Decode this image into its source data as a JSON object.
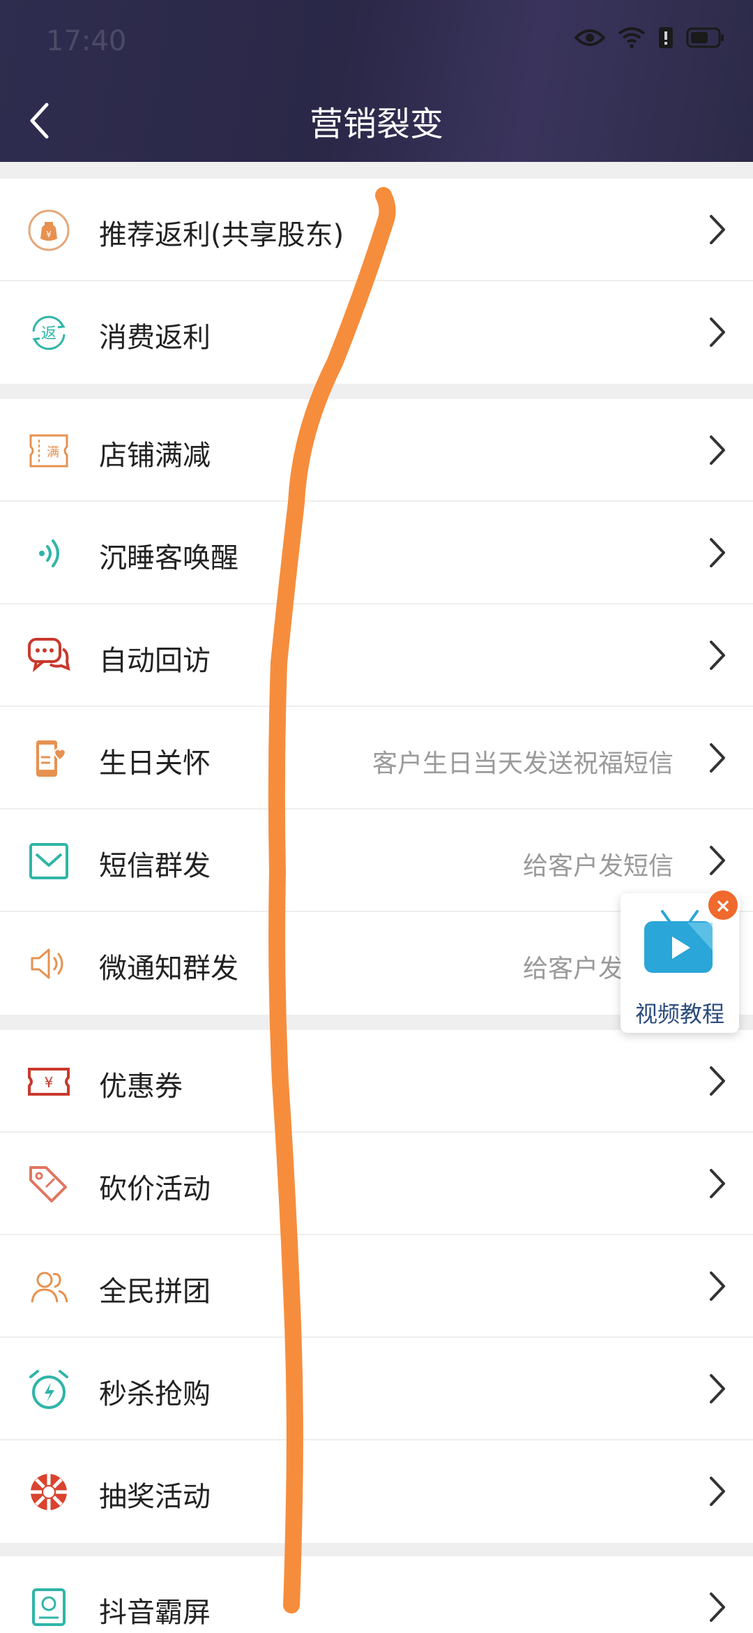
{
  "status_bar": {
    "time": "17:40"
  },
  "header": {
    "title": "营销裂变"
  },
  "groups": [
    {
      "items": [
        {
          "label": "推荐返利(共享股东)",
          "desc": "",
          "icon": "money-bag-icon"
        },
        {
          "label": "消费返利",
          "desc": "",
          "icon": "rebate-icon"
        }
      ]
    },
    {
      "items": [
        {
          "label": "店铺满减",
          "desc": "",
          "icon": "full-reduction-icon"
        },
        {
          "label": "沉睡客唤醒",
          "desc": "",
          "icon": "wake-signal-icon"
        },
        {
          "label": "自动回访",
          "desc": "",
          "icon": "chat-bubble-icon"
        },
        {
          "label": "生日关怀",
          "desc": "客户生日当天发送祝福短信",
          "icon": "phone-heart-icon"
        },
        {
          "label": "短信群发",
          "desc": "给客户发短信",
          "icon": "envelope-icon"
        },
        {
          "label": "微通知群发",
          "desc": "给客户发微信",
          "icon": "speaker-icon"
        }
      ]
    },
    {
      "items": [
        {
          "label": "优惠券",
          "desc": "",
          "icon": "coupon-icon"
        },
        {
          "label": "砍价活动",
          "desc": "",
          "icon": "price-tag-icon"
        },
        {
          "label": "全民拼团",
          "desc": "",
          "icon": "group-people-icon"
        },
        {
          "label": "秒杀抢购",
          "desc": "",
          "icon": "alarm-clock-icon"
        },
        {
          "label": "抽奖活动",
          "desc": "",
          "icon": "lottery-wheel-icon"
        }
      ]
    },
    {
      "items": [
        {
          "label": "抖音霸屏",
          "desc": "",
          "icon": "tv-screen-icon"
        }
      ]
    }
  ],
  "video_widget": {
    "label": "视频教程"
  },
  "colors": {
    "header_bg": "#2c2a4a",
    "accent_orange": "#f0692d",
    "scribble": "#f68d3c",
    "teal": "#2fb5a8",
    "red": "#c9382d"
  }
}
